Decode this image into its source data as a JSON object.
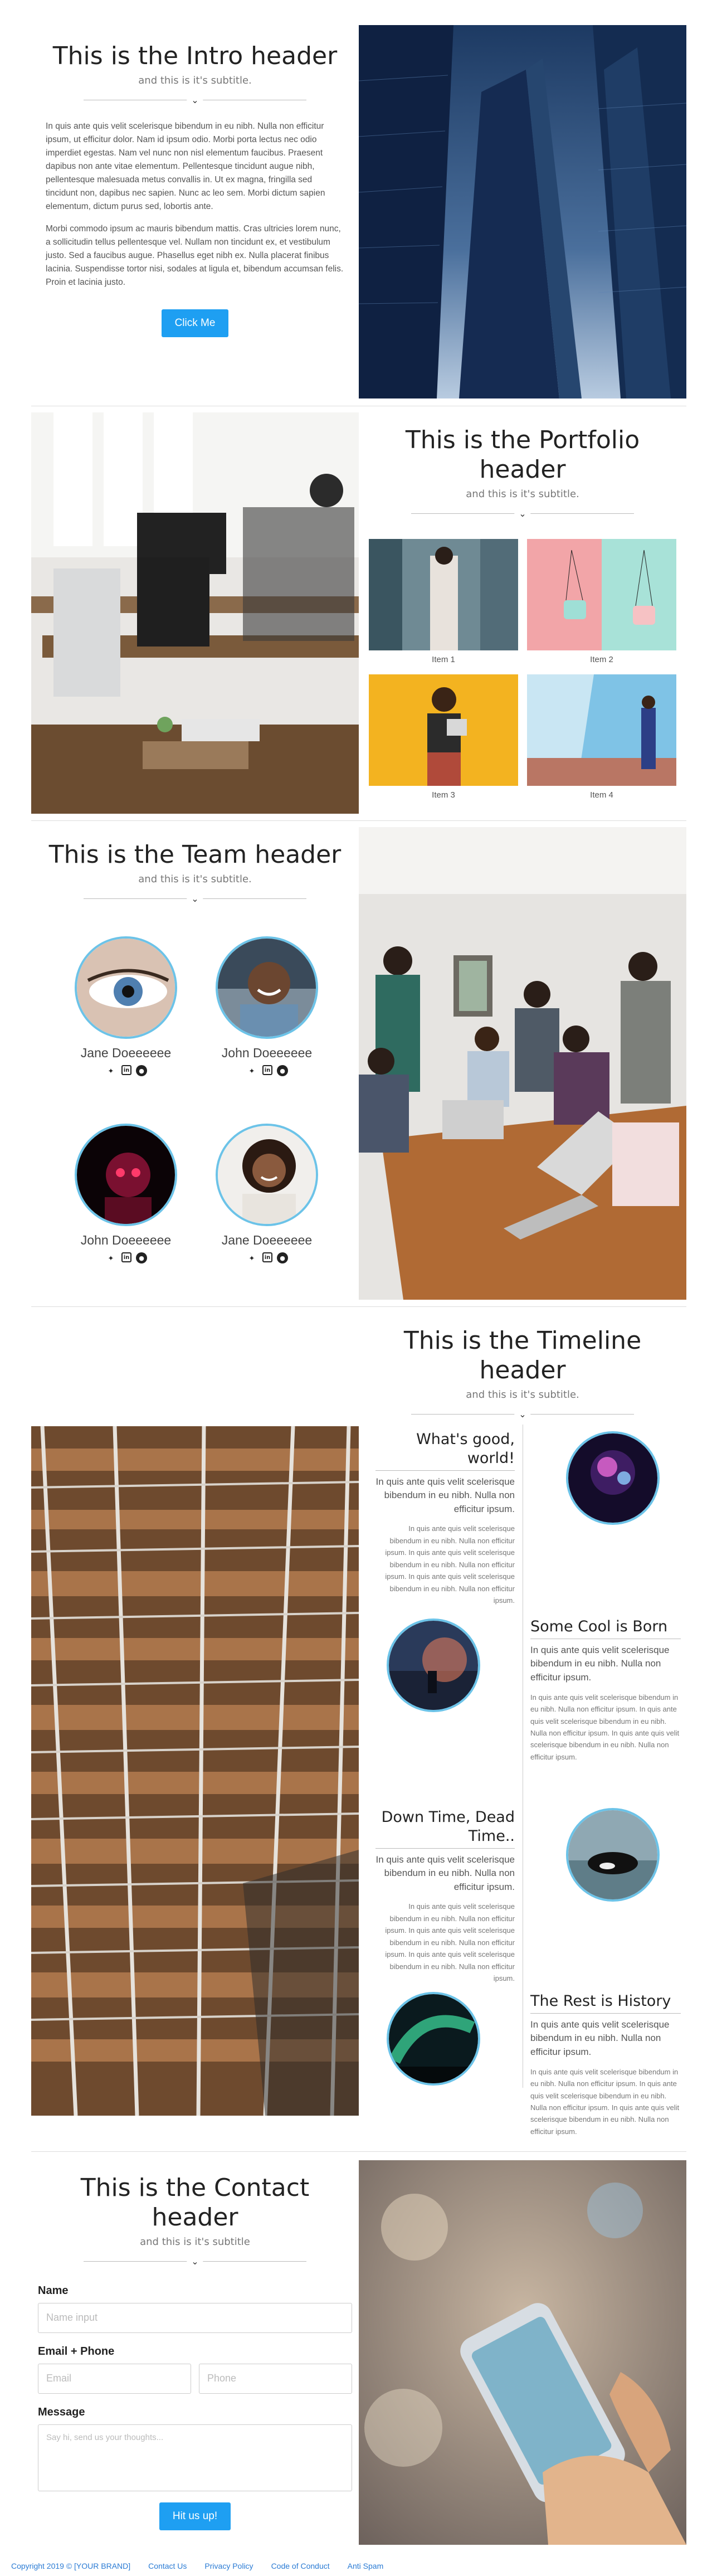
{
  "intro": {
    "header": "This is the Intro header",
    "subtitle": "and this is it's subtitle.",
    "chevron_icon": "chevron-down-icon",
    "paragraph1": "In quis ante quis velit scelerisque bibendum in eu nibh. Nulla non efficitur ipsum, ut efficitur dolor. Nam id ipsum odio. Morbi porta lectus nec odio imperdiet egestas. Nam vel nunc non nisl elementum faucibus. Praesent dapibus non ante vitae elementum. Pellentesque tincidunt augue nibh, pellentesque malesuada metus convallis in. Ut ex magna, fringilla sed tincidunt non, dapibus nec sapien. Nunc ac leo sem. Morbi dictum sapien elementum, dictum purus sed, lobortis ante.",
    "paragraph2": "Morbi commodo ipsum ac mauris bibendum mattis. Cras ultricies lorem nunc, a sollicitudin tellus pellentesque vel. Nullam non tincidunt ex, et vestibulum justo. Sed a faucibus augue. Phasellus eget nibh ex. Nulla placerat finibus lacinia. Suspendisse tortor nisi, sodales at ligula et, bibendum accumsan felis. Proin et lacinia justo.",
    "button": "Click Me"
  },
  "portfolio": {
    "header": "This is the Portfolio header",
    "subtitle": "and this is it's subtitle.",
    "items": [
      {
        "caption": "Item 1"
      },
      {
        "caption": "Item 2"
      },
      {
        "caption": "Item 3"
      },
      {
        "caption": "Item 4"
      }
    ]
  },
  "team": {
    "header": "This is the Team header",
    "subtitle": "and this is it's subtitle.",
    "members": [
      {
        "name": "Jane Doeeeeee"
      },
      {
        "name": "John Doeeeeee"
      },
      {
        "name": "John Doeeeeee"
      },
      {
        "name": "Jane Doeeeeee"
      }
    ],
    "social_icons": [
      "twitter-icon",
      "linkedin-icon",
      "github-icon"
    ]
  },
  "timeline": {
    "header": "This is the Timeline header",
    "subtitle": "and this is it's subtitle.",
    "entries": [
      {
        "title": "What's good, world!",
        "lead": "In quis ante quis velit scelerisque bibendum in eu nibh. Nulla non efficitur ipsum.",
        "text": "In quis ante quis velit scelerisque bibendum in eu nibh. Nulla non efficitur ipsum. In quis ante quis velit scelerisque bibendum in eu nibh. Nulla non efficitur ipsum. In quis ante quis velit scelerisque bibendum in eu nibh. Nulla non efficitur ipsum."
      },
      {
        "title": "Some Cool is Born",
        "lead": "In quis ante quis velit scelerisque bibendum in eu nibh. Nulla non efficitur ipsum.",
        "text": "In quis ante quis velit scelerisque bibendum in eu nibh. Nulla non efficitur ipsum. In quis ante quis velit scelerisque bibendum in eu nibh. Nulla non efficitur ipsum. In quis ante quis velit scelerisque bibendum in eu nibh. Nulla non efficitur ipsum."
      },
      {
        "title": "Down Time, Dead Time..",
        "lead": "In quis ante quis velit scelerisque bibendum in eu nibh. Nulla non efficitur ipsum.",
        "text": "In quis ante quis velit scelerisque bibendum in eu nibh. Nulla non efficitur ipsum. In quis ante quis velit scelerisque bibendum in eu nibh. Nulla non efficitur ipsum. In quis ante quis velit scelerisque bibendum in eu nibh. Nulla non efficitur ipsum."
      },
      {
        "title": "The Rest is History",
        "lead": "In quis ante quis velit scelerisque bibendum in eu nibh. Nulla non efficitur ipsum.",
        "text": "In quis ante quis velit scelerisque bibendum in eu nibh. Nulla non efficitur ipsum. In quis ante quis velit scelerisque bibendum in eu nibh. Nulla non efficitur ipsum. In quis ante quis velit scelerisque bibendum in eu nibh. Nulla non efficitur ipsum."
      }
    ]
  },
  "contact": {
    "header": "This is the Contact header",
    "subtitle": "and this is it's subtitle",
    "name_label": "Name",
    "name_placeholder": "Name input",
    "email_phone_label": "Email + Phone",
    "email_placeholder": "Email",
    "phone_placeholder": "Phone",
    "message_label": "Message",
    "message_placeholder": "Say hi, send us your thoughts...",
    "button": "Hit us up!"
  },
  "footer": {
    "copyright": "Copyright 2019 © [YOUR BRAND]",
    "links": [
      "Contact Us",
      "Privacy Policy",
      "Code of Conduct",
      "Anti Spam"
    ]
  },
  "colors": {
    "accent": "#1e9ff2",
    "avatar_ring": "#6cc3e8",
    "footer_link": "#2a7bd4"
  }
}
